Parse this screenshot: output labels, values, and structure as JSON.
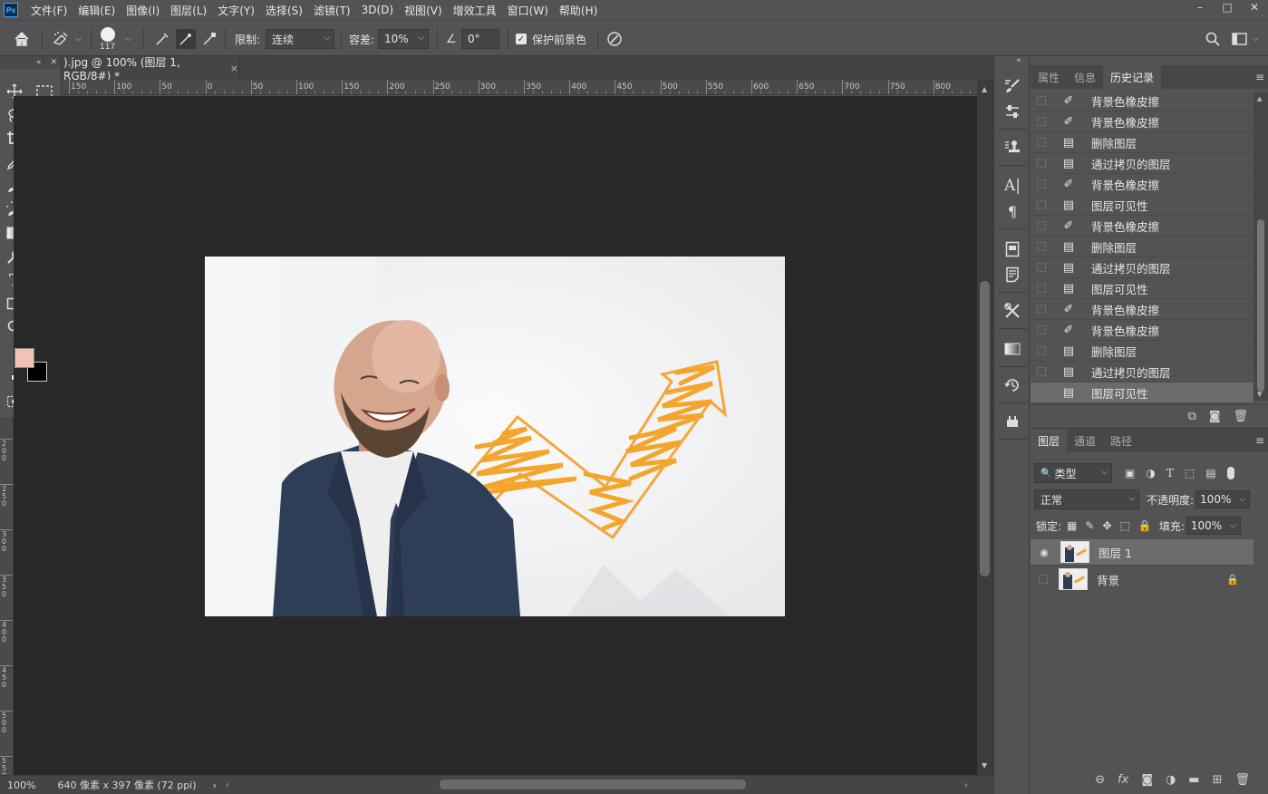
{
  "menubar": {
    "logo": "Ps",
    "items": [
      "文件(F)",
      "编辑(E)",
      "图像(I)",
      "图层(L)",
      "文字(Y)",
      "选择(S)",
      "滤镜(T)",
      "3D(D)",
      "视图(V)",
      "增效工具",
      "窗口(W)",
      "帮助(H)"
    ],
    "controls": [
      "–",
      "□",
      "✕"
    ]
  },
  "options": {
    "brush_size": "117",
    "limit_label": "限制:",
    "limit_value": "连续",
    "tolerance_label": "容差:",
    "tolerance_value": "10%",
    "angle_value": "0°",
    "protect_label": "保护前景色",
    "protect_checked": true
  },
  "document": {
    "tab_title": ").jpg @ 100% (图层 1, RGB/8#) *",
    "tab_close": "×",
    "ruler_labels": [
      "150",
      "100",
      "50",
      "0",
      "50",
      "100",
      "150",
      "200",
      "250",
      "300",
      "350",
      "400",
      "450",
      "500",
      "550",
      "600",
      "650",
      "700",
      "750",
      "800"
    ],
    "ruler_v_labels": [
      "200",
      "250",
      "300",
      "350",
      "400",
      "450",
      "500",
      "550",
      "600"
    ]
  },
  "status": {
    "zoom": "100%",
    "info": "640 像素 x 397 像素 (72 ppi)",
    "arrow": "›"
  },
  "colors": {
    "foreground": "#f2c2b4",
    "background": "#000000"
  },
  "history_panel": {
    "tabs": [
      "属性",
      "信息",
      "历史记录"
    ],
    "active_tab": "历史记录",
    "items": [
      {
        "label": "背景色橡皮擦",
        "icon": "eraser-icon"
      },
      {
        "label": "背景色橡皮擦",
        "icon": "eraser-icon"
      },
      {
        "label": "删除图层",
        "icon": "document-icon"
      },
      {
        "label": "通过拷贝的图层",
        "icon": "document-icon"
      },
      {
        "label": "背景色橡皮擦",
        "icon": "eraser-icon"
      },
      {
        "label": "图层可见性",
        "icon": "document-icon"
      },
      {
        "label": "背景色橡皮擦",
        "icon": "eraser-icon"
      },
      {
        "label": "删除图层",
        "icon": "document-icon"
      },
      {
        "label": "通过拷贝的图层",
        "icon": "document-icon"
      },
      {
        "label": "图层可见性",
        "icon": "document-icon"
      },
      {
        "label": "背景色橡皮擦",
        "icon": "eraser-icon"
      },
      {
        "label": "背景色橡皮擦",
        "icon": "eraser-icon"
      },
      {
        "label": "删除图层",
        "icon": "document-icon"
      },
      {
        "label": "通过拷贝的图层",
        "icon": "document-icon"
      },
      {
        "label": "图层可见性",
        "icon": "document-icon"
      }
    ]
  },
  "layers_panel": {
    "tabs": [
      "图层",
      "通道",
      "路径"
    ],
    "active_tab": "图层",
    "filter_value": "类型",
    "blend_mode": "正常",
    "opacity_label": "不透明度:",
    "opacity_value": "100%",
    "lock_label": "锁定:",
    "fill_label": "填充:",
    "fill_value": "100%",
    "layers": [
      {
        "name": "图层 1",
        "visible": true,
        "selected": true,
        "locked": false
      },
      {
        "name": "背景",
        "visible": false,
        "selected": false,
        "locked": true
      }
    ]
  }
}
